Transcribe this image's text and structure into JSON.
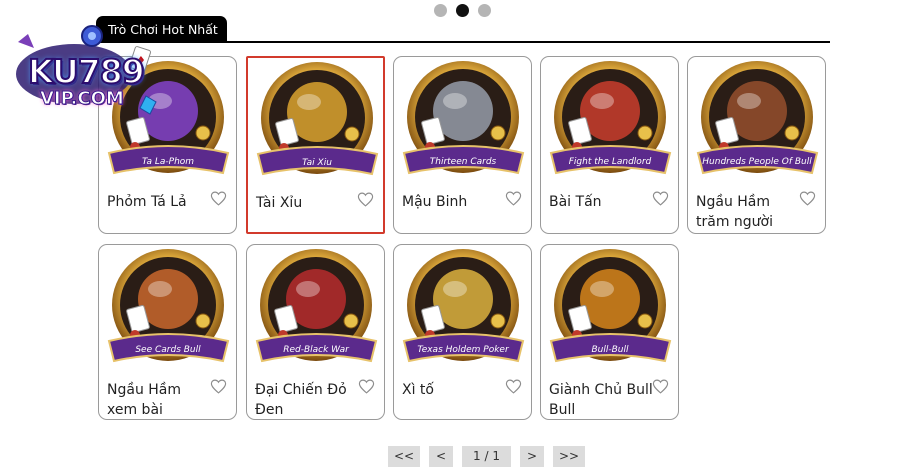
{
  "carousel": {
    "dots": [
      false,
      true,
      false
    ]
  },
  "section": {
    "tab_label": "Trò Chơi Hot Nhất"
  },
  "logo": {
    "line1": "KU789",
    "line2": "VIP.COM"
  },
  "games": [
    {
      "name": "Phỏm Tá Lả",
      "banner": "Ta La-Phom",
      "theme": "#7a3fb8",
      "selected": false
    },
    {
      "name": "Tài Xỉu",
      "banner": "Tai Xiu",
      "theme": "#c8962c",
      "selected": true
    },
    {
      "name": "Mậu Binh",
      "banner": "Thirteen Cards",
      "theme": "#8a8f9a",
      "selected": false
    },
    {
      "name": "Bài Tấn",
      "banner": "Fight the Landlord",
      "theme": "#b83a2a",
      "selected": false
    },
    {
      "name": "Ngầu Hầm trăm người",
      "banner": "Hundreds People Of Bull",
      "theme": "#8a4a2a",
      "selected": false
    },
    {
      "name": "Ngầu Hầm xem bài",
      "banner": "See Cards Bull",
      "theme": "#b8602a",
      "selected": false
    },
    {
      "name": "Đại Chiến Đỏ Đen",
      "banner": "Red-Black War",
      "theme": "#a82a2a",
      "selected": false
    },
    {
      "name": "Xì tố",
      "banner": "Texas Holdem Poker",
      "theme": "#c9a23a",
      "selected": false
    },
    {
      "name": "Giành Chủ Bull Bull",
      "banner": "Bull-Bull",
      "theme": "#c47a1a",
      "selected": false
    }
  ],
  "pager": {
    "first": "<<",
    "prev": "<",
    "current": "1 / 1",
    "next": ">",
    "last": ">>"
  },
  "colors": {
    "banner": "#5b2a8c",
    "gold": "#d9a53a",
    "selected_border": "#d23a2c"
  }
}
